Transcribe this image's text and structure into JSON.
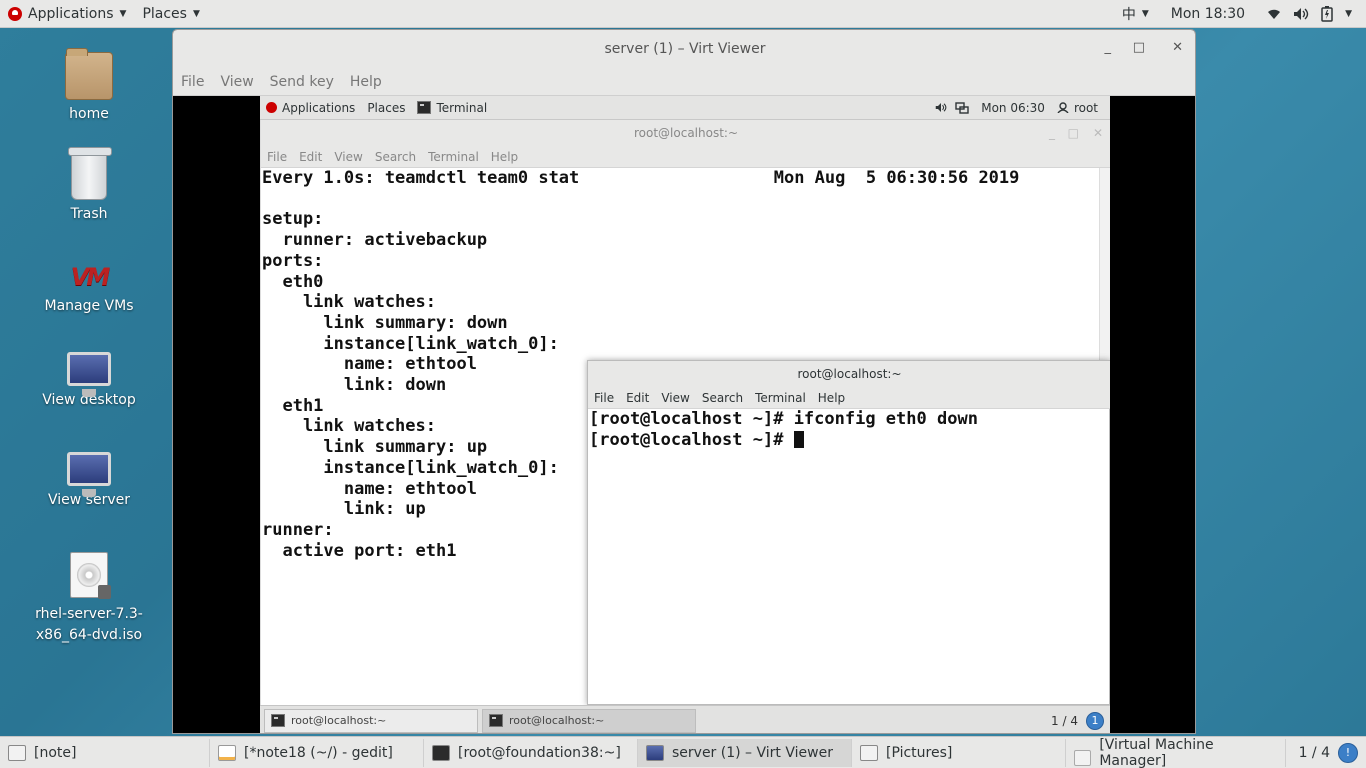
{
  "top_panel": {
    "applications": "Applications",
    "places": "Places",
    "input_method": "中",
    "clock": "Mon 18:30"
  },
  "desktop_icons": [
    {
      "label": "home"
    },
    {
      "label": "Trash"
    },
    {
      "label": "Manage VMs",
      "glyph": "VM"
    },
    {
      "label": "View desktop"
    },
    {
      "label": "View server"
    },
    {
      "label": "rhel-server-7.3-x86_64-dvd.iso"
    }
  ],
  "virt_viewer": {
    "title": "server (1) – Virt Viewer",
    "menu": [
      "File",
      "View",
      "Send key",
      "Help"
    ],
    "controls": {
      "minimize": "_",
      "maximize": "□",
      "close": "✕"
    }
  },
  "guest": {
    "panel": {
      "applications": "Applications",
      "places": "Places",
      "active_app": "Terminal",
      "clock": "Mon 06:30",
      "user": "root"
    },
    "terminal_back": {
      "title": "root@localhost:~",
      "menu": [
        "File",
        "Edit",
        "View",
        "Search",
        "Terminal",
        "Help"
      ],
      "lines": [
        "Every 1.0s: teamdctl team0 stat                   Mon Aug  5 06:30:56 2019",
        "",
        "setup:",
        "  runner: activebackup",
        "ports:",
        "  eth0",
        "    link watches:",
        "      link summary: down",
        "      instance[link_watch_0]:",
        "        name: ethtool",
        "        link: down",
        "  eth1",
        "    link watches:",
        "      link summary: up",
        "      instance[link_watch_0]:",
        "        name: ethtool",
        "        link: up",
        "runner:",
        "  active port: eth1"
      ]
    },
    "terminal_front": {
      "title": "root@localhost:~",
      "menu": [
        "File",
        "Edit",
        "View",
        "Search",
        "Terminal",
        "Help"
      ],
      "lines": [
        "[root@localhost ~]# ifconfig eth0 down",
        "[root@localhost ~]# "
      ]
    },
    "taskbar": {
      "tasks": [
        "root@localhost:~",
        "root@localhost:~"
      ],
      "pager": "1 / 4",
      "info": "1"
    }
  },
  "taskbar": {
    "tasks": [
      "[note]",
      "[*note18 (~/) - gedit]",
      "[root@foundation38:~]",
      "server (1) – Virt Viewer",
      "[Pictures]",
      "[Virtual Machine Manager]"
    ],
    "pager": "1 / 4"
  }
}
